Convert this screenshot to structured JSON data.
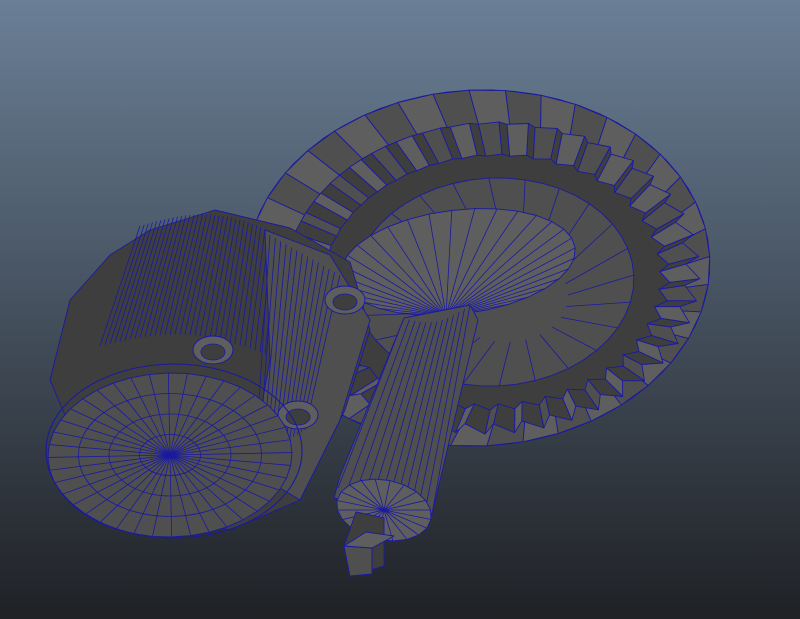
{
  "viewport": {
    "background_top": "#6a7f96",
    "background_bottom": "#1f2125",
    "mesh_fill": "#4f4f4f",
    "mesh_fill_light": "#5e5e5e",
    "mesh_fill_dark": "#3e3e3e",
    "wireframe_color": "#1a1aa0",
    "display_mode": "wireframe-on-shaded"
  },
  "objects": [
    {
      "name": "bevel-ring-gear",
      "teeth": 44
    },
    {
      "name": "pinion-shaft"
    },
    {
      "name": "differential-housing"
    }
  ]
}
